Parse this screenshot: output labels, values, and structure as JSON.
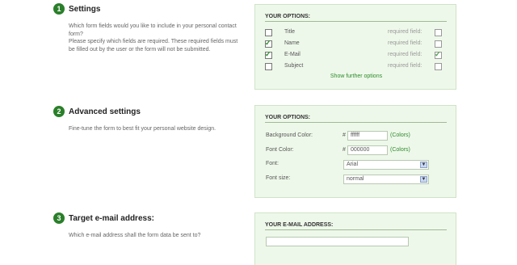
{
  "sections": [
    {
      "number": "1",
      "title": "Settings",
      "description": "Which form fields would you like to include in your personal contact form?\nPlease specify which fields are required. These required fields must be filled out by the user or the form will not be submitted.",
      "panel_title": "YOUR OPTIONS:",
      "fields": [
        {
          "label": "Title",
          "included": false,
          "required_label": "required field:",
          "required": false
        },
        {
          "label": "Name",
          "included": true,
          "required_label": "required field:",
          "required": false
        },
        {
          "label": "E-Mail",
          "included": true,
          "required_label": "required field:",
          "required": true
        },
        {
          "label": "Subject",
          "included": false,
          "required_label": "required field:",
          "required": false
        }
      ],
      "further_link": "Show further options"
    },
    {
      "number": "2",
      "title": "Advanced settings",
      "description": "Fine-tune the form to best fit your personal website design.",
      "panel_title": "YOUR OPTIONS:",
      "background_color": {
        "label": "Background Color:",
        "hash": "#",
        "value": "ffffff",
        "link": "(Colors)"
      },
      "font_color": {
        "label": "Font Color:",
        "hash": "#",
        "value": "000000",
        "link": "(Colors)"
      },
      "font": {
        "label": "Font:",
        "value": "Arial"
      },
      "font_size": {
        "label": "Font size:",
        "value": "normal"
      }
    },
    {
      "number": "3",
      "title": "Target e-mail address:",
      "description": "Which e-mail address shall the form data be sent to?",
      "panel_title": "YOUR E-MAIL ADDRESS:",
      "email_value": ""
    }
  ],
  "icons": {
    "checkbox_check": "check-icon",
    "select_arrow": "chevron-down-icon"
  },
  "colors": {
    "accent": "#2a7f2a",
    "panel_bg": "#eef8ea",
    "link": "#2e8b2e"
  }
}
